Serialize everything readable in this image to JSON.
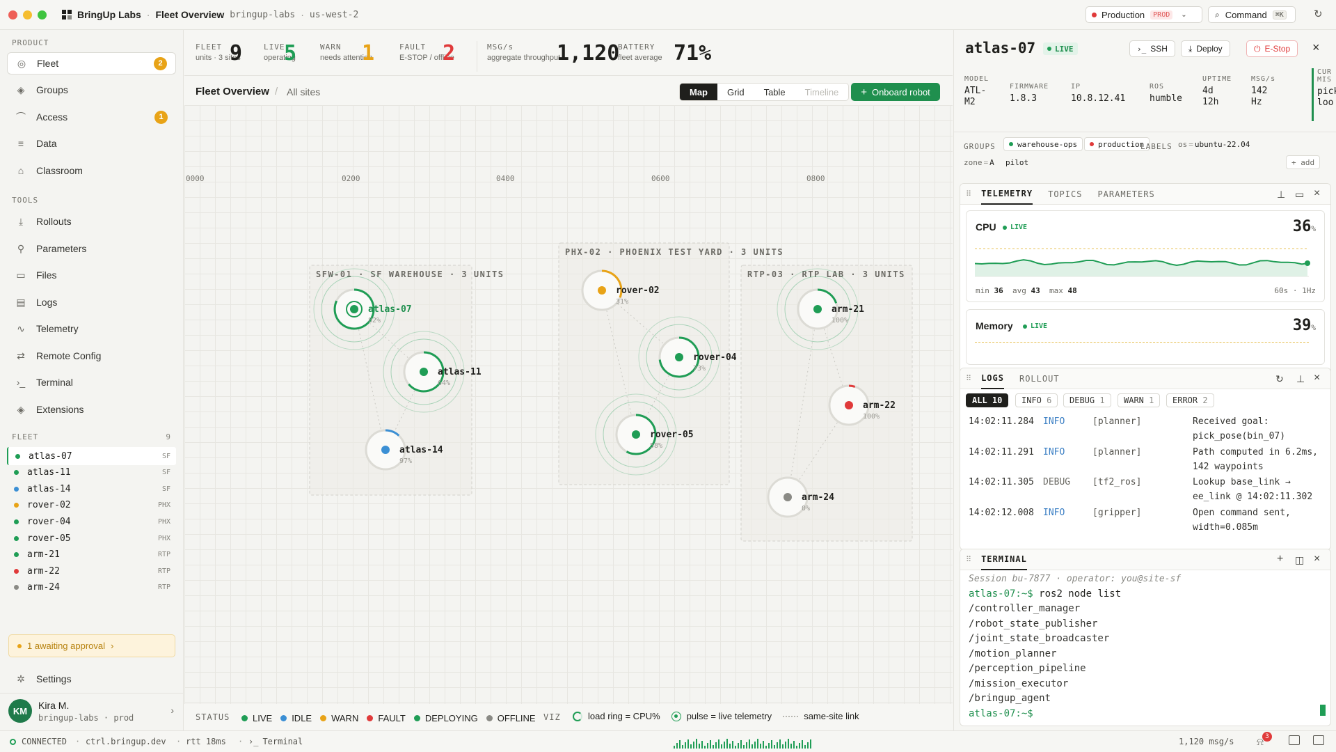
{
  "app": {
    "name": "BringUp Labs",
    "page": "Fleet Overview",
    "org": "bringup-labs",
    "region": "us-west-2"
  },
  "topbar": {
    "env_label": "Production",
    "env_badge": "PROD",
    "command_label": "Command",
    "command_kbd": "⌘K"
  },
  "sidebar": {
    "product_label": "PRODUCT",
    "product_items": [
      {
        "label": "Fleet",
        "badge": "2"
      },
      {
        "label": "Groups"
      },
      {
        "label": "Access",
        "badge": "1"
      },
      {
        "label": "Data"
      },
      {
        "label": "Classroom"
      }
    ],
    "tools_label": "TOOLS",
    "tools_items": [
      {
        "label": "Rollouts"
      },
      {
        "label": "Parameters"
      },
      {
        "label": "Files"
      },
      {
        "label": "Logs"
      },
      {
        "label": "Telemetry"
      },
      {
        "label": "Remote Config"
      },
      {
        "label": "Terminal"
      },
      {
        "label": "Extensions"
      }
    ],
    "fleet_label": "FLEET",
    "fleet_count": "9",
    "fleet": [
      {
        "name": "atlas-07",
        "site": "SF",
        "color": "#1f9d55"
      },
      {
        "name": "atlas-11",
        "site": "SF",
        "color": "#1f9d55"
      },
      {
        "name": "atlas-14",
        "site": "SF",
        "color": "#3b8fd4"
      },
      {
        "name": "rover-02",
        "site": "PHX",
        "color": "#e8a317"
      },
      {
        "name": "rover-04",
        "site": "PHX",
        "color": "#1f9d55"
      },
      {
        "name": "rover-05",
        "site": "PHX",
        "color": "#1f9d55"
      },
      {
        "name": "arm-21",
        "site": "RTP",
        "color": "#1f9d55"
      },
      {
        "name": "arm-22",
        "site": "RTP",
        "color": "#e03a3a"
      },
      {
        "name": "arm-24",
        "site": "RTP",
        "color": "#8a8a85"
      }
    ],
    "approval": "1 awaiting approval",
    "settings": "Settings",
    "user": {
      "initials": "KM",
      "name": "Kira M.",
      "org": "bringup-labs · prod"
    }
  },
  "stats": [
    {
      "label": "FLEET",
      "sub": "units · 3 sites",
      "value": "9",
      "color": "#1f1f1c"
    },
    {
      "label": "LIVE",
      "sub": "operating",
      "value": "5",
      "color": "#1f9d55"
    },
    {
      "label": "WARN",
      "sub": "needs attention",
      "value": "1",
      "color": "#e8a317"
    },
    {
      "label": "FAULT",
      "sub": "E-STOP / offline",
      "value": "2",
      "color": "#e03a3a"
    },
    {
      "label": "MSG/s",
      "sub": "aggregate throughput",
      "value": "1,120",
      "color": "#1f1f1c"
    },
    {
      "label": "BATTERY",
      "sub": "fleet average",
      "value": "71%",
      "color": "#1f1f1c"
    }
  ],
  "view": {
    "title": "Fleet Overview",
    "crumb": "All sites",
    "modes": [
      "Map",
      "Grid",
      "Table",
      "Timeline"
    ],
    "onboard": "Onboard robot"
  },
  "map": {
    "ticks": [
      "0000",
      "0200",
      "0400",
      "0600",
      "0800"
    ],
    "sites": [
      {
        "label": "SFW-01 · SF WAREHOUSE · 3 UNITS"
      },
      {
        "label": "PHX-02 · PHOENIX TEST YARD · 3 UNITS"
      },
      {
        "label": "RTP-03 · RTP LAB · 3 UNITS"
      }
    ],
    "robots": [
      {
        "name": "atlas-07",
        "pct": "82%",
        "cpu": 0.82,
        "color": "#1f9d55",
        "pulse": true
      },
      {
        "name": "atlas-11",
        "pct": "64%",
        "cpu": 0.64,
        "color": "#1f9d55",
        "pulse": true
      },
      {
        "name": "atlas-14",
        "pct": "97%",
        "cpu": 0.12,
        "color": "#3b8fd4",
        "pulse": false
      },
      {
        "name": "rover-02",
        "pct": "31%",
        "cpu": 0.31,
        "color": "#e8a317",
        "pulse": false
      },
      {
        "name": "rover-04",
        "pct": "73%",
        "cpu": 0.73,
        "color": "#1f9d55",
        "pulse": true
      },
      {
        "name": "rover-05",
        "pct": "58%",
        "cpu": 0.58,
        "color": "#1f9d55",
        "pulse": true
      },
      {
        "name": "arm-21",
        "pct": "100%",
        "cpu": 0.2,
        "color": "#1f9d55",
        "pulse": true
      },
      {
        "name": "arm-22",
        "pct": "100%",
        "cpu": 0.05,
        "color": "#e03a3a",
        "pulse": false
      },
      {
        "name": "arm-24",
        "pct": "0%",
        "cpu": 0.0,
        "color": "#8a8a85",
        "pulse": false
      }
    ]
  },
  "legend": {
    "status_label": "STATUS",
    "items": [
      {
        "label": "LIVE",
        "color": "#1f9d55"
      },
      {
        "label": "IDLE",
        "color": "#3b8fd4"
      },
      {
        "label": "WARN",
        "color": "#e8a317"
      },
      {
        "label": "FAULT",
        "color": "#e03a3a"
      },
      {
        "label": "DEPLOYING",
        "color": "#1f9d55"
      },
      {
        "label": "OFFLINE",
        "color": "#8a8a85"
      }
    ],
    "viz_label": "VIZ",
    "ring": "load ring = CPU%",
    "pulse": "pulse = live telemetry",
    "link": "same-site link"
  },
  "detail": {
    "name": "atlas-07",
    "live": "LIVE",
    "ssh": "SSH",
    "deploy": "Deploy",
    "estop": "E-Stop",
    "fields": [
      {
        "k": "MODEL",
        "v": "ATL-\nM2"
      },
      {
        "k": "FIRMWARE",
        "v": "1.8.3"
      },
      {
        "k": "IP",
        "v": "10.8.12.41"
      },
      {
        "k": "ROS",
        "v": "humble"
      },
      {
        "k": "UPTIME",
        "v": "4d\n12h"
      },
      {
        "k": "MSG/s",
        "v": "142\nHz"
      }
    ],
    "cur_k": "CUR\nMIS",
    "cur_v": "pick\nloo",
    "groups_label": "GROUPS",
    "groups": [
      "warehouse-ops",
      "production"
    ],
    "labels_label": "LABELS",
    "labels": [
      {
        "k": "os",
        "v": "ubuntu-22.04"
      },
      {
        "k": "zone",
        "v": "A"
      },
      {
        "k": "",
        "v": "pilot"
      }
    ],
    "add": "+ add"
  },
  "telemetry": {
    "tabs": [
      "TELEMETRY",
      "TOPICS",
      "PARAMETERS"
    ],
    "cpu": {
      "label": "CPU",
      "live": "LIVE",
      "value": "36",
      "unit": "%",
      "min": "36",
      "avg": "43",
      "max": "48",
      "window": "60s · 1Hz"
    },
    "mem": {
      "label": "Memory",
      "live": "LIVE",
      "value": "39",
      "unit": "%"
    }
  },
  "logs": {
    "tabs": [
      "LOGS",
      "ROLLOUT"
    ],
    "filters": [
      {
        "label": "ALL",
        "n": "10"
      },
      {
        "label": "INFO",
        "n": "6"
      },
      {
        "label": "DEBUG",
        "n": "1"
      },
      {
        "label": "WARN",
        "n": "1"
      },
      {
        "label": "ERROR",
        "n": "2"
      }
    ],
    "rows": [
      {
        "t": "14:02:11.284",
        "lvl": "INFO",
        "src": "[planner]",
        "msg1": "Received goal:",
        "msg2": "pick_pose(bin_07)"
      },
      {
        "t": "14:02:11.291",
        "lvl": "INFO",
        "src": "[planner]",
        "msg1": "Path computed in 6.2ms,",
        "msg2": "142 waypoints"
      },
      {
        "t": "14:02:11.305",
        "lvl": "DEBUG",
        "src": "[tf2_ros]",
        "msg1": "Lookup base_link →",
        "msg2": "ee_link @ 14:02:11.302"
      },
      {
        "t": "14:02:12.008",
        "lvl": "INFO",
        "src": "[gripper]",
        "msg1": "Open command sent,",
        "msg2": "width=0.085m"
      }
    ]
  },
  "terminal": {
    "tab": "TERMINAL",
    "session": "Session bu-7877 · operator: you@site-sf",
    "prompt": "atlas-07:~$",
    "cmd": "ros2 node list",
    "lines": [
      "/controller_manager",
      "/robot_state_publisher",
      "/joint_state_broadcaster",
      "/motion_planner",
      "/perception_pipeline",
      "/mission_executor",
      "/bringup_agent"
    ]
  },
  "status": {
    "conn": "CONNECTED",
    "host": "ctrl.bringup.dev",
    "rtt": "rtt 18ms",
    "terminal": "Terminal",
    "rate": "1,120 msg/s",
    "notif": "3"
  }
}
